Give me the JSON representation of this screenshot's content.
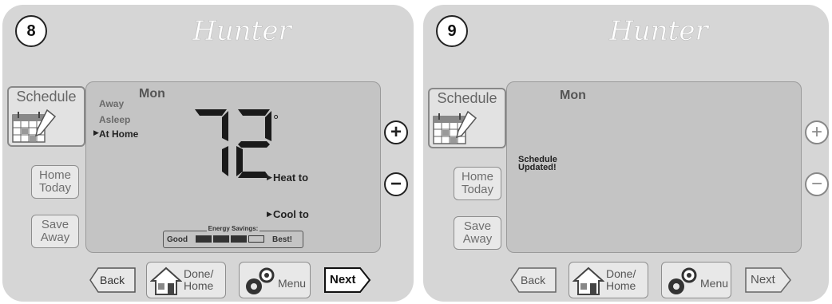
{
  "brand": "Hunter",
  "panels": [
    {
      "step": "8",
      "schedule_label": "Schedule",
      "home_today": [
        "Home",
        "Today"
      ],
      "save_away": [
        "Save",
        "Away"
      ],
      "day": "Mon",
      "modes": [
        "Away",
        "Asleep",
        "At Home"
      ],
      "active_mode": "At Home",
      "temperature": "72",
      "degree": "°",
      "heat_to": "Heat to",
      "cool_to": "Cool to",
      "energy": {
        "title": "Energy Savings:",
        "good": "Good",
        "best": "Best!"
      },
      "plus": "+",
      "minus": "−",
      "back": "Back",
      "done_home": [
        "Done/",
        "Home"
      ],
      "menu": "Menu",
      "next": "Next"
    },
    {
      "step": "9",
      "schedule_label": "Schedule",
      "home_today": [
        "Home",
        "Today"
      ],
      "save_away": [
        "Save",
        "Away"
      ],
      "day": "Mon",
      "message": [
        "Schedule",
        "Updated!"
      ],
      "plus": "+",
      "minus": "−",
      "back": "Back",
      "done_home": [
        "Done/",
        "Home"
      ],
      "menu": "Menu",
      "next": "Next"
    }
  ],
  "colors": {
    "bezel": "#d6d6d6",
    "screen": "#c4c4c4",
    "button": "#e8e8e8"
  }
}
